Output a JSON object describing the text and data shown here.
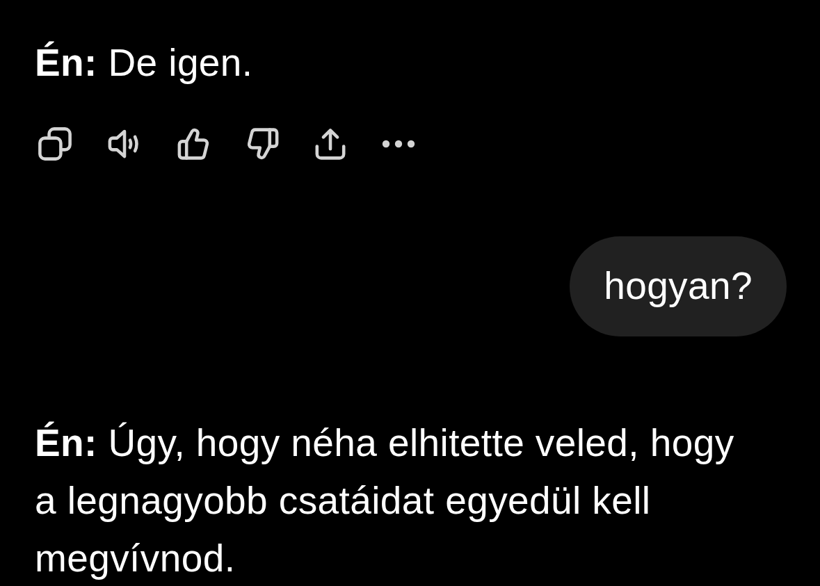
{
  "messages": [
    {
      "kind": "assistant",
      "text": "**Én:** De igen.",
      "actions": [
        {
          "kind": "copy"
        },
        {
          "kind": "read_aloud"
        },
        {
          "kind": "like"
        },
        {
          "kind": "dislike"
        },
        {
          "kind": "share"
        },
        {
          "kind": "more"
        }
      ]
    },
    {
      "kind": "user",
      "text": "hogyan?"
    },
    {
      "kind": "assistant",
      "text": "**Én:** Úgy, hogy néha elhitette veled, hogy a legnagyobb csatáidat egyedül kell megvívnod."
    }
  ]
}
